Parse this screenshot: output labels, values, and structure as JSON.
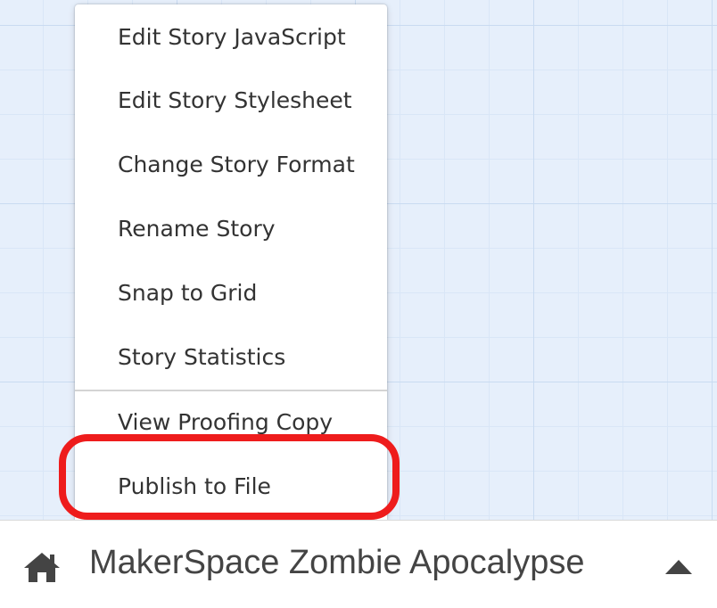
{
  "menu": {
    "items": [
      {
        "label": "Edit Story JavaScript"
      },
      {
        "label": "Edit Story Stylesheet"
      },
      {
        "label": "Change Story Format"
      },
      {
        "label": "Rename Story"
      },
      {
        "label": "Snap to Grid"
      },
      {
        "label": "Story Statistics"
      },
      {
        "label": "View Proofing Copy"
      },
      {
        "label": "Publish to File"
      }
    ]
  },
  "footer": {
    "home_icon": "home-icon",
    "story_title": "MakerSpace Zombie Apocalypse",
    "menu_toggle_icon": "caret-up-icon"
  },
  "annotation": {
    "highlight_color": "#ee1c1c"
  }
}
